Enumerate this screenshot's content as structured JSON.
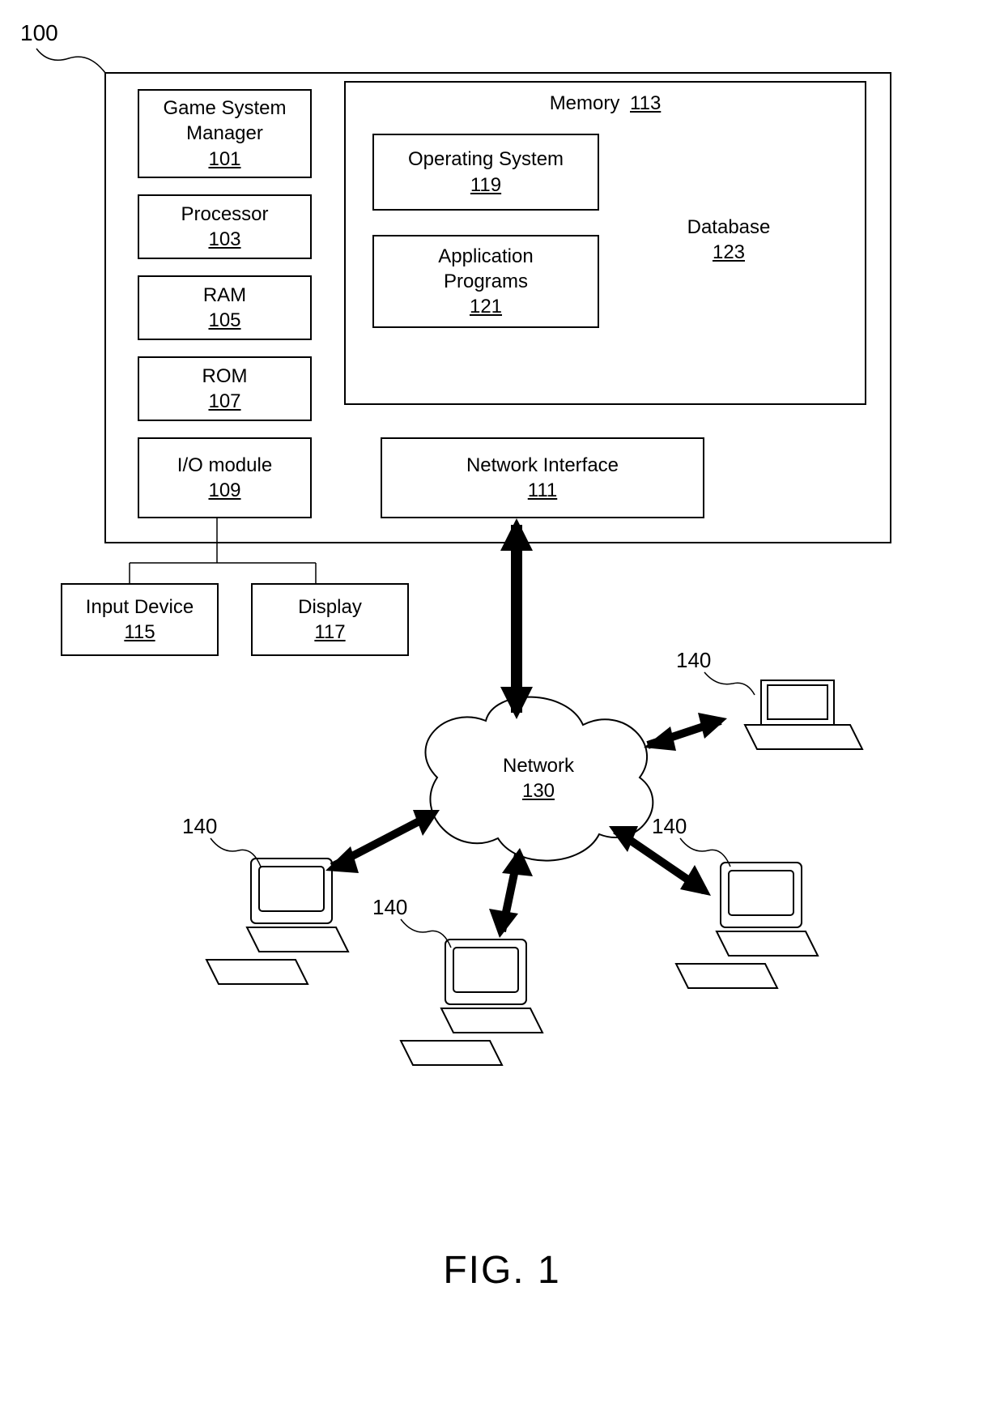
{
  "figureLabel": "FIG. 1",
  "systemRef": "100",
  "mainBox": {},
  "blocks": {
    "gsm": {
      "label": "Game System\nManager",
      "num": "101"
    },
    "processor": {
      "label": "Processor",
      "num": "103"
    },
    "ram": {
      "label": "RAM",
      "num": "105"
    },
    "rom": {
      "label": "ROM",
      "num": "107"
    },
    "io": {
      "label": "I/O module",
      "num": "109"
    },
    "memory": {
      "label": "Memory",
      "num": "113"
    },
    "os": {
      "label": "Operating System",
      "num": "119"
    },
    "apps": {
      "label": "Application\nPrograms",
      "num": "121"
    },
    "db": {
      "label": "Database",
      "num": "123"
    },
    "nic": {
      "label": "Network Interface",
      "num": "111"
    },
    "input": {
      "label": "Input Device",
      "num": "115"
    },
    "display": {
      "label": "Display",
      "num": "117"
    },
    "network": {
      "label": "Network",
      "num": "130"
    }
  },
  "clientRef": "140"
}
